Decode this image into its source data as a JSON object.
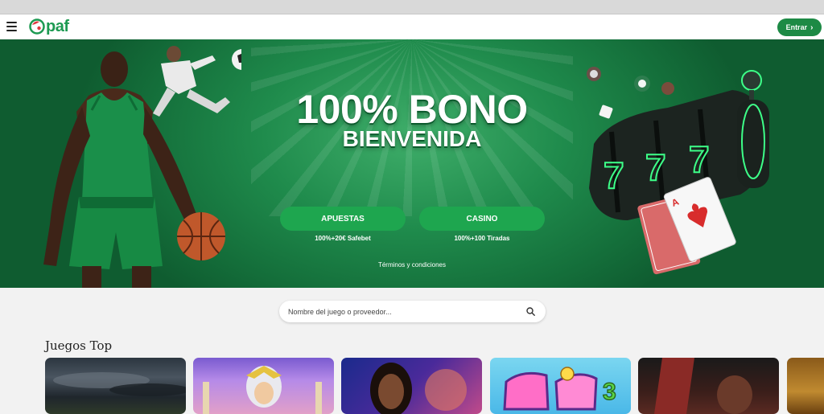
{
  "header": {
    "logo_text": "paf",
    "menu_icon": "hamburger-menu-icon",
    "enter_label": "Entrar",
    "enter_icon": "chevron-right-icon"
  },
  "hero": {
    "title_line1": "100% BONO",
    "title_line2": "BIENVENIDA",
    "buttons": [
      {
        "label": "APUESTAS",
        "sub": "100%+20€ Safebet"
      },
      {
        "label": "CASINO",
        "sub": "100%+100 Tiradas"
      }
    ],
    "terms": "Términos y condiciones"
  },
  "search": {
    "placeholder": "Nombre del juego o proveedor...",
    "icon": "search-icon"
  },
  "games": {
    "section_title": "Juegos Top",
    "tiles": [
      {
        "name": "game-tile-1"
      },
      {
        "name": "game-tile-2"
      },
      {
        "name": "game-tile-3"
      },
      {
        "name": "game-tile-4"
      },
      {
        "name": "game-tile-5"
      },
      {
        "name": "game-tile-6"
      }
    ]
  },
  "colors": {
    "brand_green": "#1d8a45",
    "cta_green": "#1ea64f",
    "hero_green": "#1f8b4c",
    "logo_red": "#e0383e"
  }
}
